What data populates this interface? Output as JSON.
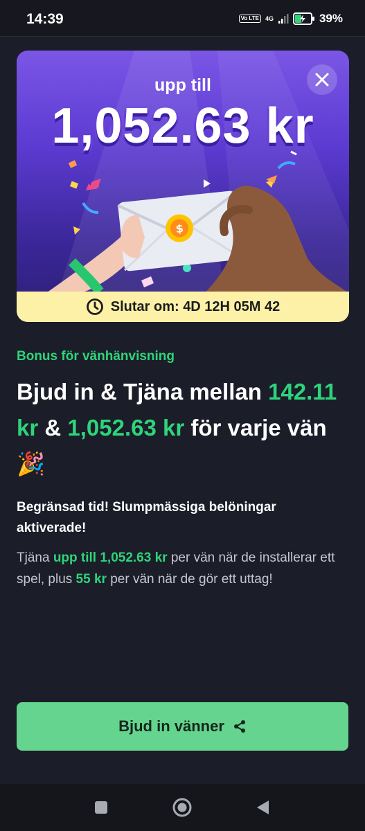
{
  "status_bar": {
    "time": "14:39",
    "volte": "Vo LTE",
    "network": "4G",
    "battery_percent": "39%"
  },
  "banner": {
    "up_to_label": "upp till",
    "amount": "1,052.63 kr",
    "timer_label": "Slutar om: 4D 12H 05M 42",
    "icons": {
      "close": "close-icon",
      "clock": "clock-icon"
    }
  },
  "content": {
    "eyebrow": "Bonus för vänhänvisning",
    "headline": {
      "part1": "Bjud in & Tjäna mellan ",
      "amount_min": "142.11 kr",
      "and": " & ",
      "amount_max": "1,052.63 kr",
      "part2": " för varje vän ",
      "emoji": "🎉"
    },
    "subtitle": "Begränsad tid! Slumpmässiga belöningar aktiverade!",
    "description": {
      "part1": "Tjäna ",
      "highlight1": "upp till 1,052.63 kr",
      "part2": " per vän när de installerar ett spel, plus ",
      "highlight2": "55 kr",
      "part3": " per vän när de gör ett uttag!"
    }
  },
  "cta": {
    "label": "Bjud in vänner",
    "icon": "share-icon"
  },
  "colors": {
    "accent_green": "#2ed47a",
    "cta_green": "#64d48e",
    "background": "#1b1d29",
    "banner_purple": "#5c3bd2",
    "timer_yellow": "#fdf1a8"
  }
}
